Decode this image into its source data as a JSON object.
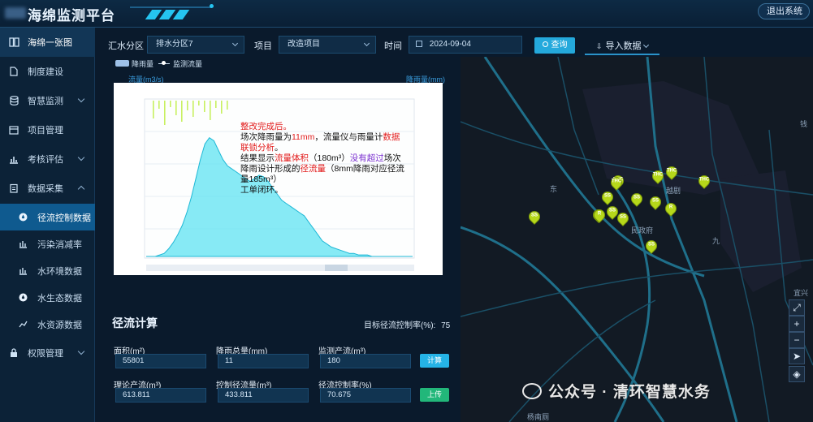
{
  "header": {
    "title": "海绵监测平台",
    "logout_label": "退出系统"
  },
  "sidebar": {
    "items": [
      {
        "label": "海绵一张图",
        "icon": "map-book-icon"
      },
      {
        "label": "制度建设",
        "icon": "document-icon"
      },
      {
        "label": "智慧监测",
        "icon": "database-icon"
      },
      {
        "label": "项目管理",
        "icon": "folder-icon"
      },
      {
        "label": "考核评估",
        "icon": "bar-chart-icon"
      },
      {
        "label": "数据采集",
        "icon": "clipboard-icon"
      },
      {
        "label": "权限管理",
        "icon": "lock-icon"
      }
    ],
    "sub_items": [
      {
        "label": "径流控制数据",
        "icon": "drop-icon"
      },
      {
        "label": "污染消减率",
        "icon": "chart-icon"
      },
      {
        "label": "水环境数据",
        "icon": "chart-icon"
      },
      {
        "label": "水生态数据",
        "icon": "drop-icon"
      },
      {
        "label": "水资源数据",
        "icon": "chart-icon"
      }
    ]
  },
  "filter": {
    "district_label": "汇水分区",
    "district_value": "排水分区7",
    "project_label": "项目",
    "project_value": "改造项目",
    "time_label": "时间",
    "time_value": "2024-09-04",
    "query_label": "查询",
    "import_label": "导入数据"
  },
  "chart": {
    "legend_rain": "降雨量",
    "legend_flow": "监测流量",
    "left_axis_title": "流量(m3/s)",
    "right_axis_title": "降雨量(mm)"
  },
  "chart_data": {
    "type": "area",
    "series": [
      {
        "name": "监测流量",
        "y": [
          0,
          0,
          0,
          1,
          2,
          5,
          9,
          14,
          20,
          28,
          38,
          50,
          62,
          72,
          76,
          74,
          68,
          62,
          58,
          56,
          54,
          52,
          50,
          48,
          50,
          52,
          51,
          48,
          44,
          40,
          36,
          34,
          32,
          30,
          28,
          26,
          22,
          18,
          14,
          10,
          8,
          6,
          5,
          4,
          3,
          2,
          2,
          1,
          1,
          1,
          0,
          0,
          0,
          0,
          0,
          0,
          0,
          0,
          0,
          0
        ]
      }
    ]
  },
  "note": {
    "l1": "整改完成后。",
    "l2a": "场次降雨量为",
    "l2b": "11mm",
    "l2c": "，流量仪与雨量计",
    "l2d": "数据联锁分析",
    "l2e": "。",
    "l3a": "结果显示",
    "l3b": "流量体积",
    "l3c": "（180m³）",
    "l3d": "没有超过",
    "l3e": "场次降雨设计形成的",
    "l3f": "径流量",
    "l3g": "（8mm降雨对应径流量185m³）",
    "l4": "工单闭环。"
  },
  "calc": {
    "title": "径流计算",
    "target_label": "目标径流控制率(%):",
    "target_value": "75",
    "area_label": "面积(m²)",
    "area_value": "55801",
    "rain_label": "降雨总量(mm)",
    "rain_value": "11",
    "monitor_label": "监测产流(m³)",
    "monitor_value": "180",
    "calc_button": "计算",
    "theory_label": "理论产流(m³)",
    "theory_value": "613.811",
    "control_label": "控制径流量(m³)",
    "control_value": "433.811",
    "rate_label": "径流控制率(%)",
    "rate_value": "70.675",
    "upload_button": "上传"
  },
  "map": {
    "labels": {
      "l1": "东",
      "l2": "民政府",
      "l3": "越剧",
      "l4": "九",
      "l5": "钱",
      "l6": "宜兴",
      "l7": "杨南厕"
    },
    "pins": [
      "THC",
      "THC",
      "THC",
      "THC",
      "SS",
      "SS",
      "SS",
      "SS",
      "SS",
      "R",
      "R",
      "THC",
      "SS",
      "SS",
      "SS"
    ]
  },
  "watermark": "公众号 · 清环智慧水务"
}
